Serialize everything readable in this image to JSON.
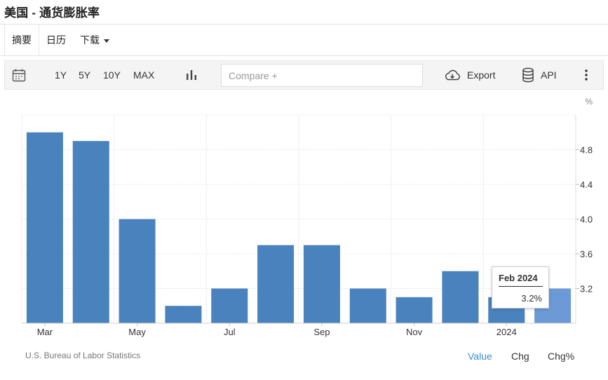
{
  "page": {
    "title": "美国 - 通货膨胀率"
  },
  "tabs": [
    {
      "label": "摘要"
    },
    {
      "label": "日历"
    },
    {
      "label": "下载"
    }
  ],
  "toolbar": {
    "ranges": [
      "1Y",
      "5Y",
      "10Y",
      "MAX"
    ],
    "compare_placeholder": "Compare +",
    "export_label": "Export",
    "api_label": "API"
  },
  "chart_data": {
    "type": "bar",
    "unit_label": "%",
    "categories": [
      "2023-03",
      "2023-04",
      "2023-05",
      "2023-06",
      "2023-07",
      "2023-08",
      "2023-09",
      "2023-10",
      "2023-11",
      "2023-12",
      "2024-01",
      "2024-02"
    ],
    "values": [
      5.0,
      4.9,
      4.0,
      3.0,
      3.2,
      3.7,
      3.7,
      3.2,
      3.1,
      3.4,
      3.1,
      3.2
    ],
    "highlight_index": 11,
    "ylim": [
      2.8,
      5.2
    ],
    "yticks": [
      3.2,
      3.6,
      4.0,
      4.4,
      4.8
    ],
    "ytick_labels": [
      "3.2",
      "3.6",
      "4.0",
      "4.4",
      "4.8"
    ],
    "xtick_labels": [
      {
        "index": 0,
        "label": "Mar"
      },
      {
        "index": 2,
        "label": "May"
      },
      {
        "index": 4,
        "label": "Jul"
      },
      {
        "index": 6,
        "label": "Sep"
      },
      {
        "index": 8,
        "label": "Nov"
      },
      {
        "index": 10,
        "label": "2024"
      }
    ],
    "bar_color": "#4a82be",
    "highlight_color": "#6b9ad6",
    "grid": true,
    "tooltip": {
      "date": "Feb 2024",
      "value": "3.2%"
    }
  },
  "footer": {
    "source": "U.S. Bureau of Labor Statistics",
    "modes": [
      {
        "label": "Value",
        "color": "#3a8fcf"
      },
      {
        "label": "Chg",
        "color": "#333333"
      },
      {
        "label": "Chg%",
        "color": "#333333"
      }
    ]
  }
}
